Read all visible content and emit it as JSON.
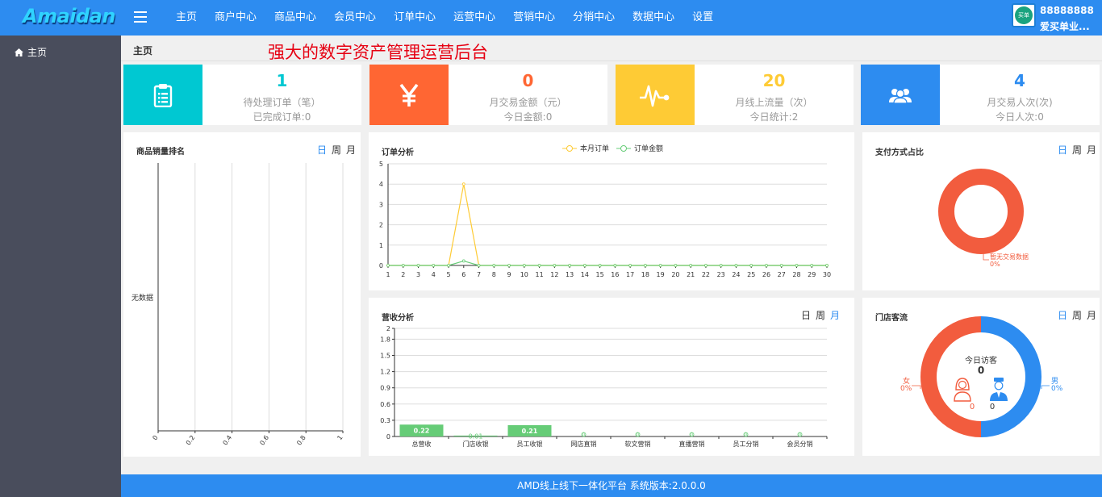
{
  "header": {
    "logo": "Amaidan",
    "nav": [
      "主页",
      "商户中心",
      "商品中心",
      "会员中心",
      "订单中心",
      "运营中心",
      "营销中心",
      "分销中心",
      "数据中心",
      "设置"
    ],
    "user_id": "88888888",
    "user_shop": "爱买单业...",
    "avatar_text": "买单"
  },
  "sidebar": {
    "home": "主页"
  },
  "breadcrumb": "主页",
  "slogan": "强大的数字资产管理运营后台",
  "stats": [
    {
      "value": "1",
      "line1": "待处理订单（笔）",
      "line2": "已完成订单:0",
      "color": "#00c8d2"
    },
    {
      "value": "0",
      "line1": "月交易金额（元）",
      "line2": "今日金额:0",
      "color": "#ff6633"
    },
    {
      "value": "20",
      "line1": "月线上流量（次）",
      "line2": "今日统计:2",
      "color": "#fecb35"
    },
    {
      "value": "4",
      "line1": "月交易人次(次)",
      "line2": "今日人次:0",
      "color": "#2d8cf0"
    }
  ],
  "toggle": {
    "day": "日",
    "week": "周",
    "month": "月"
  },
  "panels": {
    "ranking": {
      "title": "商品销量排名",
      "empty": "无数据",
      "ticks": [
        "0",
        "0.2",
        "0.4",
        "0.6",
        "0.8",
        "1"
      ]
    },
    "orders": {
      "title": "订单分析",
      "legend": [
        "本月订单",
        "订单金额"
      ]
    },
    "revenue": {
      "title": "营收分析"
    },
    "payment": {
      "title": "支付方式占比",
      "label": "暂无交易数据",
      "pct": "0%"
    },
    "traffic": {
      "title": "门店客流",
      "center_label": "今日访客",
      "center_value": "0",
      "female": "女",
      "male": "男",
      "female_pct": "0%",
      "male_pct": "0%",
      "female_count": "0",
      "male_count": "0"
    }
  },
  "chart_data": [
    {
      "type": "line",
      "title": "订单分析",
      "x": [
        1,
        2,
        3,
        4,
        5,
        6,
        7,
        8,
        9,
        10,
        11,
        12,
        13,
        14,
        15,
        16,
        17,
        18,
        19,
        20,
        21,
        22,
        23,
        24,
        25,
        26,
        27,
        28,
        29,
        30
      ],
      "ylim": [
        0,
        5
      ],
      "yticks": [
        0,
        1,
        2,
        3,
        4,
        5
      ],
      "series": [
        {
          "name": "本月订单",
          "color": "#fecb35",
          "values": [
            0,
            0,
            0,
            0,
            0,
            4,
            0,
            0,
            0,
            0,
            0,
            0,
            0,
            0,
            0,
            0,
            0,
            0,
            0,
            0,
            0,
            0,
            0,
            0,
            0,
            0,
            0,
            0,
            0,
            0
          ]
        },
        {
          "name": "订单金额",
          "color": "#66cc77",
          "values": [
            0,
            0,
            0,
            0,
            0,
            0.22,
            0,
            0,
            0,
            0,
            0,
            0,
            0,
            0,
            0,
            0,
            0,
            0,
            0,
            0,
            0,
            0,
            0,
            0,
            0,
            0,
            0,
            0,
            0,
            0
          ]
        }
      ],
      "legend": "top-center",
      "grid": true
    },
    {
      "type": "bar",
      "title": "营收分析",
      "categories": [
        "总营收",
        "门店收银",
        "员工收银",
        "网店直销",
        "软文营销",
        "直播营销",
        "员工分销",
        "会员分销"
      ],
      "values": [
        0.22,
        0.01,
        0.21,
        0,
        0,
        0,
        0,
        0
      ],
      "labels": [
        "0.22",
        "0.01",
        "0.21",
        "0",
        "0",
        "0",
        "0",
        "0"
      ],
      "ylim": [
        0,
        2
      ],
      "yticks": [
        "0",
        "0.3",
        "0.6",
        "0.9",
        "1.2",
        "1.5",
        "1.8",
        "2"
      ],
      "color": "#66cc77",
      "grid": true
    },
    {
      "type": "bar",
      "title": "商品销量排名",
      "categories": [],
      "values": [],
      "xlim": [
        0,
        1
      ],
      "xticks": [
        "0",
        "0.2",
        "0.4",
        "0.6",
        "0.8",
        "1"
      ]
    },
    {
      "type": "pie",
      "title": "支付方式占比",
      "labels": [
        "暂无交易数据"
      ],
      "values": [
        0
      ],
      "color": "#f25c3e"
    },
    {
      "type": "pie",
      "title": "门店客流",
      "labels": [
        "女",
        "男"
      ],
      "values": [
        0,
        0
      ],
      "colors": [
        "#f25c3e",
        "#2d8cf0"
      ]
    }
  ]
}
